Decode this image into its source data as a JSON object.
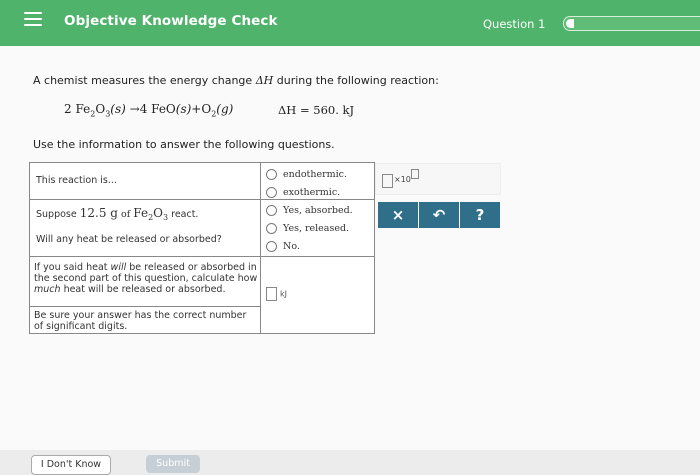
{
  "header": {
    "title": "Objective Knowledge Check",
    "question_label": "Question 1"
  },
  "intro_text": "A chemist measures the energy change",
  "intro_math": "ΔH",
  "intro_tail": "during the following reaction:",
  "reaction": {
    "lhs_coef": "2",
    "lhs_species": "Fe",
    "lhs_sub1": "2",
    "lhs_o": "O",
    "lhs_sub2": "3",
    "lhs_state": "(s)",
    "arrow": "→",
    "rhs1": "4 FeO",
    "rhs1_state": "(s)",
    "plus": "+",
    "rhs2": "O",
    "rhs2_sub": "2",
    "rhs2_state": "(g)",
    "delta_h": "ΔH = 560. kJ"
  },
  "use_text": "Use the information to answer the following questions.",
  "table": {
    "row1_prompt": "This reaction is...",
    "row1_options": [
      "endothermic.",
      "exothermic."
    ],
    "row2_prompt_a": "Suppose",
    "row2_mass": "12.5 g",
    "row2_of": "of",
    "row2_formula_a": "Fe",
    "row2_sub_a": "2",
    "row2_formula_b": "O",
    "row2_sub_b": "3",
    "row2_tail": "react.",
    "row2_question": "Will any heat be released or absorbed?",
    "row2_options": [
      "Yes, absorbed.",
      "Yes, released.",
      "No."
    ],
    "row3_line1": "If you said heat",
    "row3_will": "will",
    "row3_line1b": "be released or absorbed in the second part of this question, calculate how",
    "row3_much": "much",
    "row3_line2": "heat will be released or absorbed.",
    "row3_note": "Be sure your answer has the correct number of significant digits.",
    "unit": "kJ"
  },
  "sci_notation_label": "×10",
  "buttons": {
    "clear": "×",
    "undo": "↶",
    "help": "?"
  },
  "footer": {
    "dont_know": "I Don't Know",
    "submit": "Submit"
  }
}
